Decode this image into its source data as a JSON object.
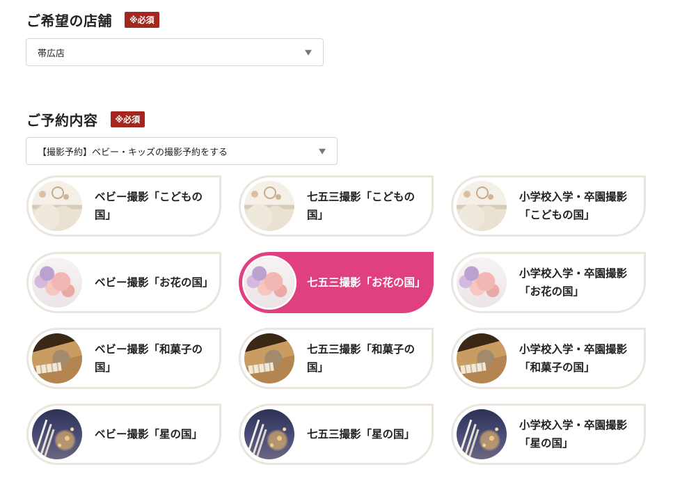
{
  "store_section": {
    "title": "ご希望の店舗",
    "required_badge": "※必須",
    "select_value": "帯広店"
  },
  "reservation_section": {
    "title": "ご予約内容",
    "required_badge": "※必須",
    "select_value": "【撮影予約】ベビー・キッズの撮影予約をする"
  },
  "plans": [
    {
      "label_line1": "ベビー撮影「こどもの",
      "label_line2": "国」",
      "theme": "kodomo",
      "selected": false
    },
    {
      "label_line1": "七五三撮影「こどもの",
      "label_line2": "国」",
      "theme": "kodomo",
      "selected": false
    },
    {
      "label_line1": "小学校入学・卒園撮影",
      "label_line2": "「こどもの国」",
      "theme": "kodomo",
      "selected": false
    },
    {
      "label_line1": "ベビー撮影「お花の国」",
      "label_line2": "",
      "theme": "ohana",
      "selected": false
    },
    {
      "label_line1": "七五三撮影「お花の国」",
      "label_line2": "",
      "theme": "ohana",
      "selected": true
    },
    {
      "label_line1": "小学校入学・卒園撮影",
      "label_line2": "「お花の国」",
      "theme": "ohana",
      "selected": false
    },
    {
      "label_line1": "ベビー撮影「和菓子の",
      "label_line2": "国」",
      "theme": "wagashi",
      "selected": false
    },
    {
      "label_line1": "七五三撮影「和菓子の",
      "label_line2": "国」",
      "theme": "wagashi",
      "selected": false
    },
    {
      "label_line1": "小学校入学・卒園撮影",
      "label_line2": "「和菓子の国」",
      "theme": "wagashi",
      "selected": false
    },
    {
      "label_line1": "ベビー撮影「星の国」",
      "label_line2": "",
      "theme": "hoshi",
      "selected": false
    },
    {
      "label_line1": "七五三撮影「星の国」",
      "label_line2": "",
      "theme": "hoshi",
      "selected": false
    },
    {
      "label_line1": "小学校入学・卒園撮影",
      "label_line2": "「星の国」",
      "theme": "hoshi",
      "selected": false
    }
  ],
  "colors": {
    "required_badge": "#a4271f",
    "selected_card": "#e0407f",
    "card_border": "#ebe6dd"
  }
}
